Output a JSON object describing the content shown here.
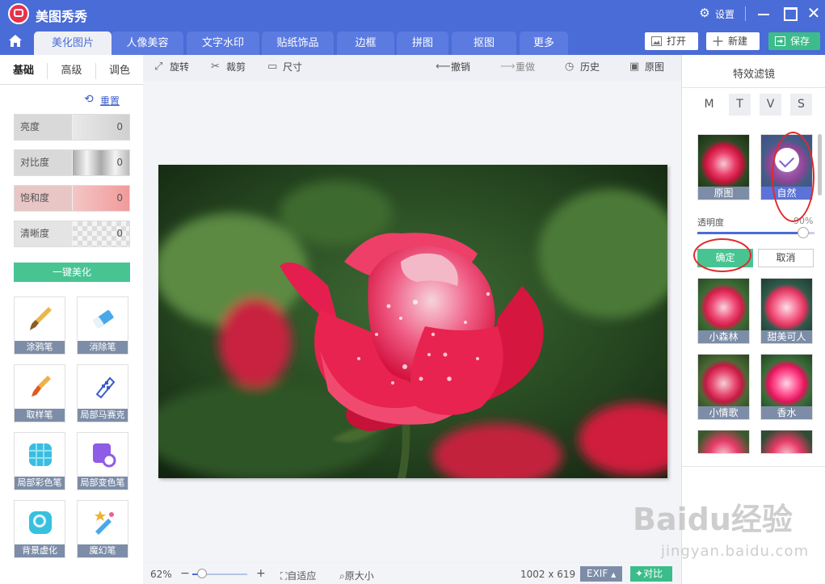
{
  "app": {
    "title": "美图秀秀",
    "settings_label": "设置"
  },
  "tabs": [
    {
      "label": "美化图片",
      "active": true
    },
    {
      "label": "人像美容"
    },
    {
      "label": "文字水印"
    },
    {
      "label": "贴纸饰品"
    },
    {
      "label": "边框"
    },
    {
      "label": "拼图"
    },
    {
      "label": "抠图"
    },
    {
      "label": "更多"
    }
  ],
  "top_buttons": {
    "open": "打开",
    "new": "新建",
    "save": "保存"
  },
  "left_panel": {
    "tabs": [
      "基础",
      "高级",
      "调色"
    ],
    "reset_label": "重置",
    "sliders": [
      {
        "label": "亮度",
        "value": "0"
      },
      {
        "label": "对比度",
        "value": "0"
      },
      {
        "label": "饱和度",
        "value": "0"
      },
      {
        "label": "清晰度",
        "value": "0"
      }
    ],
    "one_click": "一键美化",
    "tools": [
      "涂鸦笔",
      "消除笔",
      "取样笔",
      "局部马赛克",
      "局部彩色笔",
      "局部变色笔",
      "背景虚化",
      "魔幻笔"
    ]
  },
  "toolbar": {
    "rotate": "旋转",
    "crop": "裁剪",
    "size": "尺寸",
    "undo": "撤销",
    "redo": "重做",
    "history": "历史",
    "original": "原图"
  },
  "status": {
    "zoom": "62%",
    "zoom_fraction": 0.17,
    "fit": "自适应",
    "actual": "原大小",
    "dimensions": "1002 x 619",
    "exif": "EXIF",
    "compare": "对比"
  },
  "right_panel": {
    "title": "特效滤镜",
    "categories": [
      "M",
      "T",
      "V",
      "S"
    ],
    "selected_row": [
      {
        "label": "原图",
        "selected": false
      },
      {
        "label": "自然",
        "selected": true
      }
    ],
    "opacity_label": "透明度",
    "opacity_value": "90%",
    "opacity_fraction": 0.9,
    "confirm": "确定",
    "cancel": "取消",
    "filters": [
      "小森林",
      "甜美可人",
      "小情歌",
      "香水"
    ]
  },
  "watermark": {
    "main": "Baidu经验",
    "sub": "jingyan.baidu.com"
  },
  "colors": {
    "header": "#4a6cd6",
    "accent_green": "#48c493",
    "annotation": "#e02a2a"
  }
}
